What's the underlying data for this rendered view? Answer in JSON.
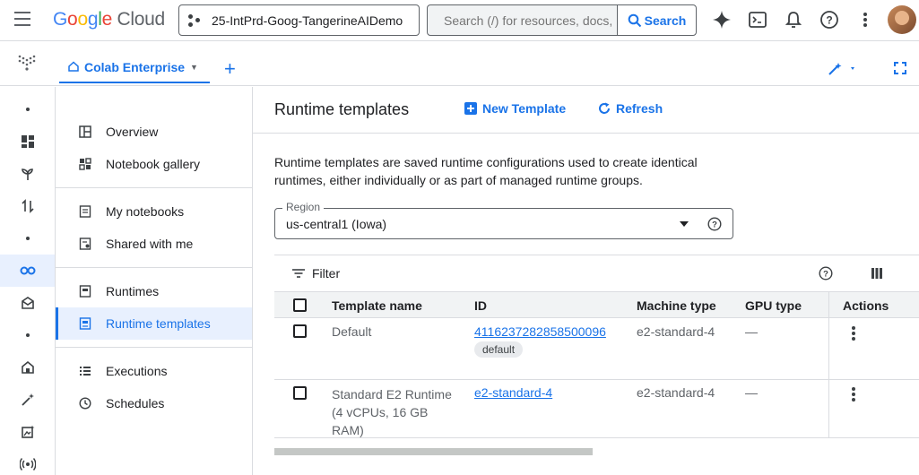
{
  "topbar": {
    "logo_google": [
      "G",
      "o",
      "o",
      "g",
      "l",
      "e"
    ],
    "logo_cloud": "Cloud",
    "project": "25-IntPrd-Goog-TangerineAIDemo",
    "search_placeholder": "Search (/) for resources, docs, products, and more",
    "search_button": "Search"
  },
  "subbar": {
    "tab_label": "Colab Enterprise"
  },
  "nav": {
    "items": [
      {
        "label": "Overview",
        "icon": "overview-icon"
      },
      {
        "label": "Notebook gallery",
        "icon": "gallery-icon"
      },
      {
        "label": "My notebooks",
        "icon": "notebook-icon"
      },
      {
        "label": "Shared with me",
        "icon": "shared-icon"
      },
      {
        "label": "Runtimes",
        "icon": "runtime-icon"
      },
      {
        "label": "Runtime templates",
        "icon": "template-icon"
      },
      {
        "label": "Executions",
        "icon": "list-icon"
      },
      {
        "label": "Schedules",
        "icon": "clock-icon"
      }
    ]
  },
  "main": {
    "title": "Runtime templates",
    "new_template": "New Template",
    "refresh": "Refresh",
    "description": "Runtime templates are saved runtime configurations used to create identical runtimes, either individually or as part of managed runtime groups.",
    "region_label": "Region",
    "region_value": "us-central1 (Iowa)",
    "filter_label": "Filter",
    "columns": [
      "Template name",
      "ID",
      "Machine type",
      "GPU type",
      "Actions"
    ],
    "rows": [
      {
        "name": "Default",
        "id": "4116237282858500096",
        "chip": "default",
        "machine": "e2-standard-4",
        "gpu": "—"
      },
      {
        "name": "Standard E2 Runtime (4 vCPUs, 16 GB RAM)",
        "id": "e2-standard-4",
        "machine": "e2-standard-4",
        "gpu": "—"
      }
    ]
  },
  "colors": {
    "accent": "#1a73e8",
    "active_bg": "#e8f0fe",
    "border": "#dadce0"
  }
}
